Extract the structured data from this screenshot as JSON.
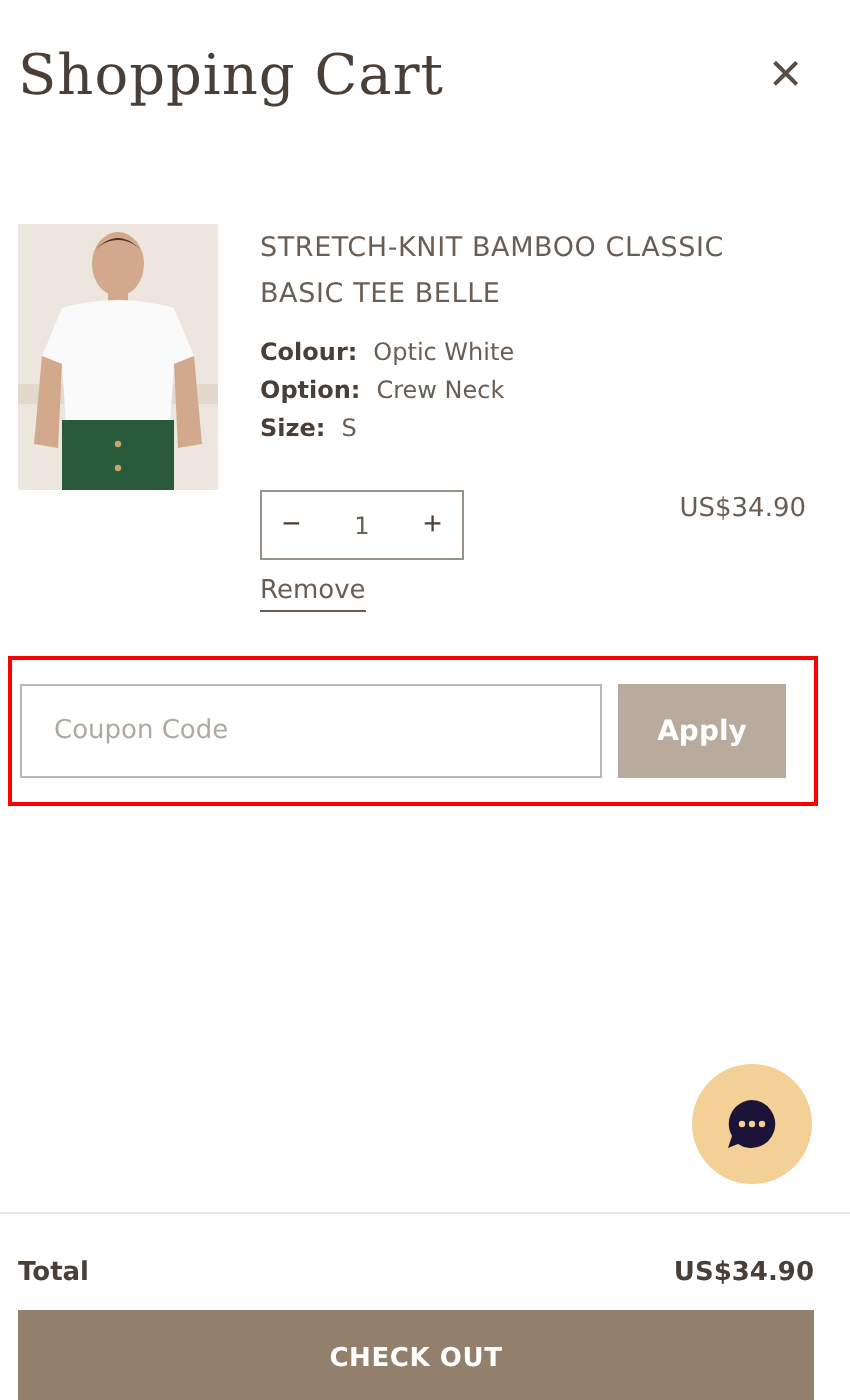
{
  "header": {
    "title": "Shopping Cart",
    "close": "×"
  },
  "item": {
    "name": "STRETCH-KNIT BAMBOO CLASSIC BASIC TEE BELLE",
    "options": [
      {
        "label": "Colour:",
        "value": "Optic White"
      },
      {
        "label": "Option:",
        "value": "Crew Neck"
      },
      {
        "label": "Size:",
        "value": "S"
      }
    ],
    "quantity": {
      "minus": "−",
      "value": "1",
      "plus": "+"
    },
    "price": "US$34.90",
    "remove": "Remove"
  },
  "coupon": {
    "placeholder": "Coupon Code",
    "button": "Apply",
    "highlighted": true
  },
  "total": {
    "label": "Total",
    "value": "US$34.90"
  },
  "checkout": "CHECK OUT"
}
